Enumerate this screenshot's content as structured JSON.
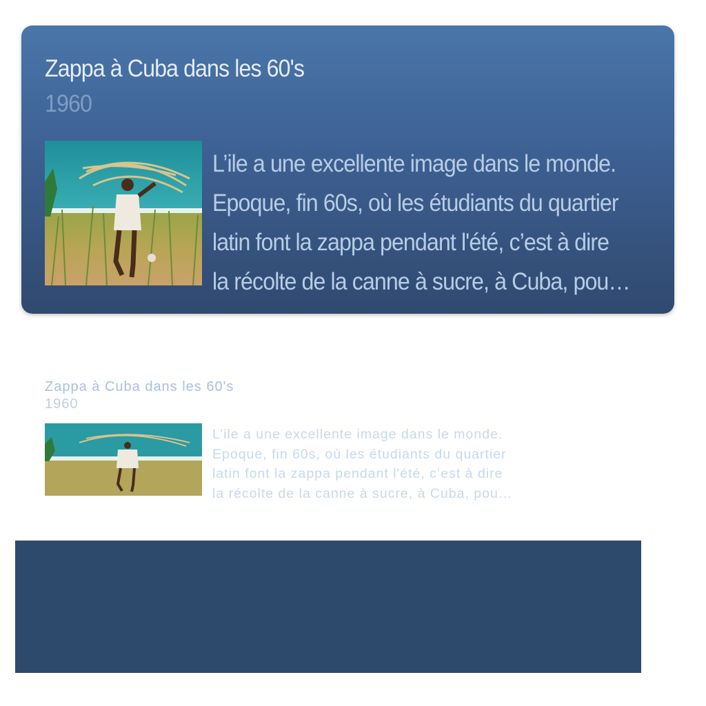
{
  "card": {
    "title": "Zappa à Cuba dans les 60's",
    "year": "1960",
    "description_lines": [
      "L’ile a une excellente image dans le monde.",
      "Epoque, fin 60s, où les étudiants du quartier",
      "latin font la zappa pendant l'été, c’est à dire",
      "la récolte de la canne à sucre, à Cuba, pou…"
    ],
    "image": "sugarcane-harvest-photo"
  },
  "reflection": {
    "title": "Zappa à Cuba dans les 60's",
    "year": "1960",
    "description_lines": [
      "L’ile a une excellente image dans le monde.",
      "Epoque, fin 60s, où les étudiants du quartier",
      "latin font la zappa pendant l'été, c’est à dire",
      "la récolte de la canne à sucre, à Cuba, pou…"
    ]
  },
  "colors": {
    "card_top": "#4a76aa",
    "card_bottom": "#30496f",
    "panel": "#2d4a6d"
  }
}
